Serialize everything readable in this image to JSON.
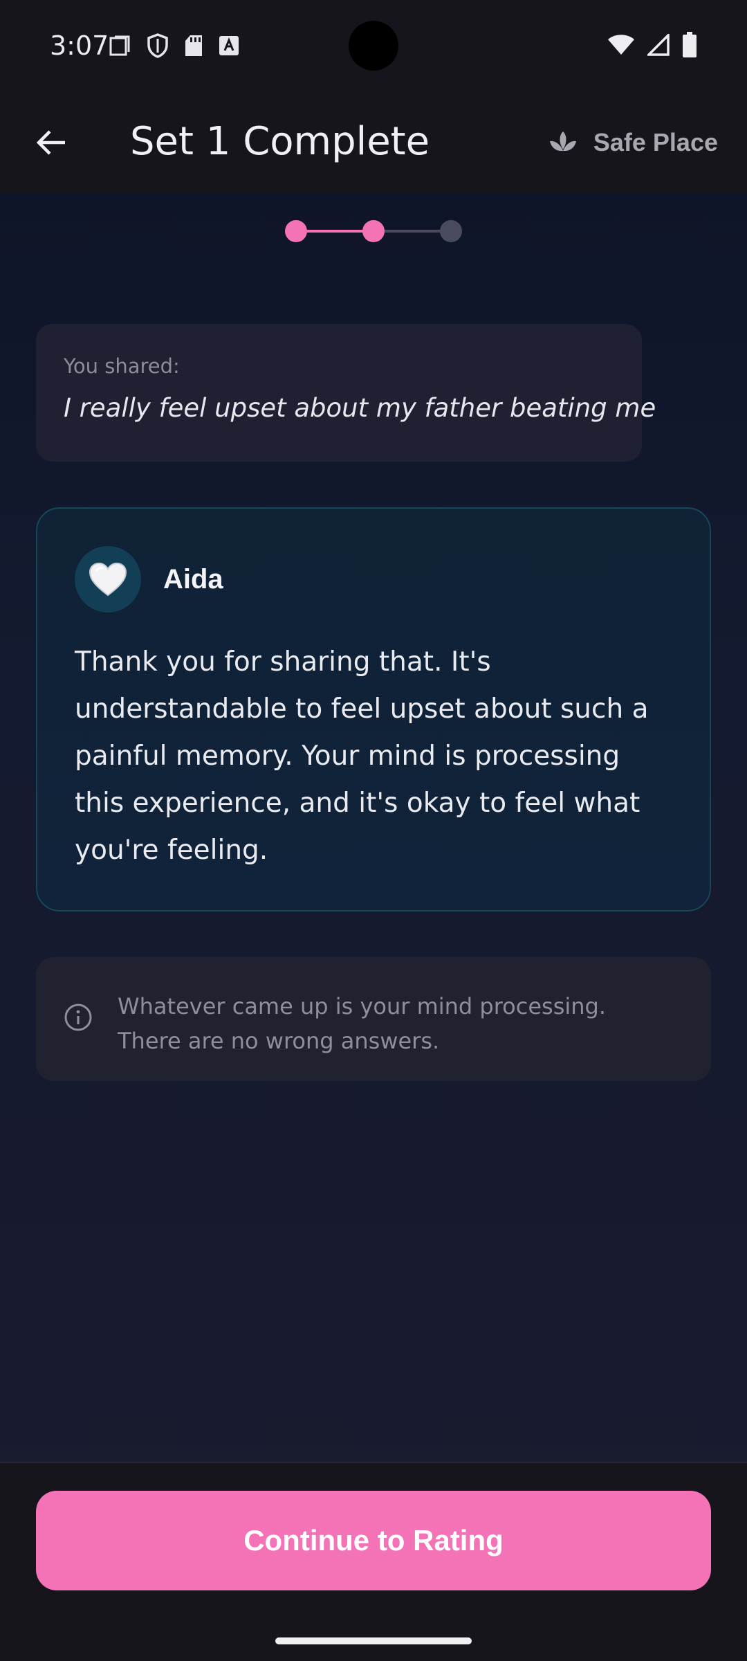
{
  "status_bar": {
    "time": "3:07",
    "left_icons": [
      "notification-square-icon",
      "shield-icon",
      "sd-card-icon",
      "font-a-icon"
    ],
    "right_icons": [
      "wifi-icon",
      "signal-icon",
      "battery-icon"
    ]
  },
  "app_bar": {
    "back_icon": "arrow-left-icon",
    "title": "Set 1 Complete",
    "safe_place_icon": "lotus-icon",
    "safe_place_label": "Safe Place"
  },
  "stepper": {
    "total_steps": 3,
    "completed_steps": 2,
    "active_color": "#f472b6",
    "inactive_color": "#4a4b5c"
  },
  "shared": {
    "label": "You shared:",
    "text": "I really feel upset about my father beating me"
  },
  "aida": {
    "avatar_icon": "white-heart-icon",
    "name": "Aida",
    "message": "Thank you for sharing that. It's understandable to feel upset about such a painful memory. Your mind is processing this experience, and it's okay to feel what you're feeling."
  },
  "info": {
    "icon": "info-circle-icon",
    "text": "Whatever came up is your mind processing. There are no wrong answers."
  },
  "footer": {
    "continue_label": "Continue to Rating",
    "accent_color": "#f472b6"
  }
}
